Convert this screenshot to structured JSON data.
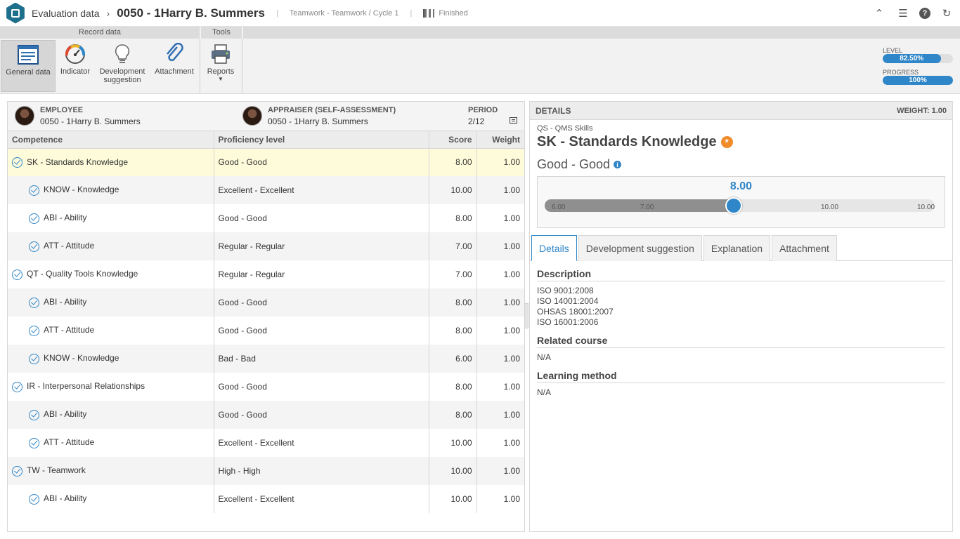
{
  "header": {
    "app_title": "Evaluation data",
    "record_title": "0050 - 1Harry B. Summers",
    "context": "Teamwork - Teamwork / Cycle 1",
    "status": "Finished"
  },
  "ribbon": {
    "groups": {
      "record_data": "Record data",
      "tools": "Tools"
    },
    "buttons": {
      "general_data": "General data",
      "indicator": "Indicator",
      "development_suggestion": "Development suggestion",
      "attachment": "Attachment",
      "reports": "Reports"
    },
    "level": {
      "label": "LEVEL",
      "value": "82.50%",
      "fraction": 0.825
    },
    "progress": {
      "label": "PROGRESS",
      "value": "100%",
      "fraction": 1.0
    }
  },
  "employee_panel": {
    "employee_label": "EMPLOYEE",
    "employee_value": "0050 - 1Harry B. Summers",
    "appraiser_label": "APPRAISER (SELF-ASSESSMENT)",
    "appraiser_value": "0050 - 1Harry B. Summers",
    "period_label": "PERIOD",
    "period_value": "2/12"
  },
  "grid": {
    "columns": {
      "competence": "Competence",
      "proficiency": "Proficiency level",
      "score": "Score",
      "weight": "Weight"
    },
    "rows": [
      {
        "competence": "SK - Standards Knowledge",
        "proficiency": "Good - Good",
        "score": "8.00",
        "weight": "1.00"
      },
      {
        "competence": "KNOW - Knowledge",
        "proficiency": "Excellent - Excellent",
        "score": "10.00",
        "weight": "1.00"
      },
      {
        "competence": "ABI - Ability",
        "proficiency": "Good - Good",
        "score": "8.00",
        "weight": "1.00"
      },
      {
        "competence": "ATT - Attitude",
        "proficiency": "Regular - Regular",
        "score": "7.00",
        "weight": "1.00"
      },
      {
        "competence": "QT - Quality Tools Knowledge",
        "proficiency": "Regular - Regular",
        "score": "7.00",
        "weight": "1.00"
      },
      {
        "competence": "ABI - Ability",
        "proficiency": "Good - Good",
        "score": "8.00",
        "weight": "1.00"
      },
      {
        "competence": "ATT - Attitude",
        "proficiency": "Good - Good",
        "score": "8.00",
        "weight": "1.00"
      },
      {
        "competence": "KNOW - Knowledge",
        "proficiency": "Bad - Bad",
        "score": "6.00",
        "weight": "1.00"
      },
      {
        "competence": "IR - Interpersonal Relationships",
        "proficiency": "Good - Good",
        "score": "8.00",
        "weight": "1.00"
      },
      {
        "competence": "ABI - Ability",
        "proficiency": "Good - Good",
        "score": "8.00",
        "weight": "1.00"
      },
      {
        "competence": "ATT - Attitude",
        "proficiency": "Excellent - Excellent",
        "score": "10.00",
        "weight": "1.00"
      },
      {
        "competence": "TW - Teamwork",
        "proficiency": "High - High",
        "score": "10.00",
        "weight": "1.00"
      },
      {
        "competence": "ABI - Ability",
        "proficiency": "Excellent - Excellent",
        "score": "10.00",
        "weight": "1.00"
      }
    ]
  },
  "details": {
    "header": "DETAILS",
    "weight": "WEIGHT: 1.00",
    "crumb": "QS - QMS Skills",
    "title": "SK - Standards Knowledge",
    "proficiency": "Good - Good",
    "slider": {
      "value": "8.00",
      "value_num": 8.0,
      "ticks": [
        "6.00",
        "7.00",
        "10.00",
        "10.00"
      ]
    },
    "tabs": [
      "Details",
      "Development suggestion",
      "Explanation",
      "Attachment"
    ],
    "description_title": "Description",
    "description_lines": [
      "ISO 9001:2008",
      "ISO 14001:2004",
      "OHSAS 18001:2007",
      "ISO 16001:2006"
    ],
    "related_course_title": "Related course",
    "related_course": "N/A",
    "learning_method_title": "Learning method",
    "learning_method": "N/A"
  },
  "colors": {
    "accent": "#2f86c8",
    "selection": "#fdfbd9",
    "brand": "#1d6f8c",
    "warning": "#f08c2a"
  }
}
